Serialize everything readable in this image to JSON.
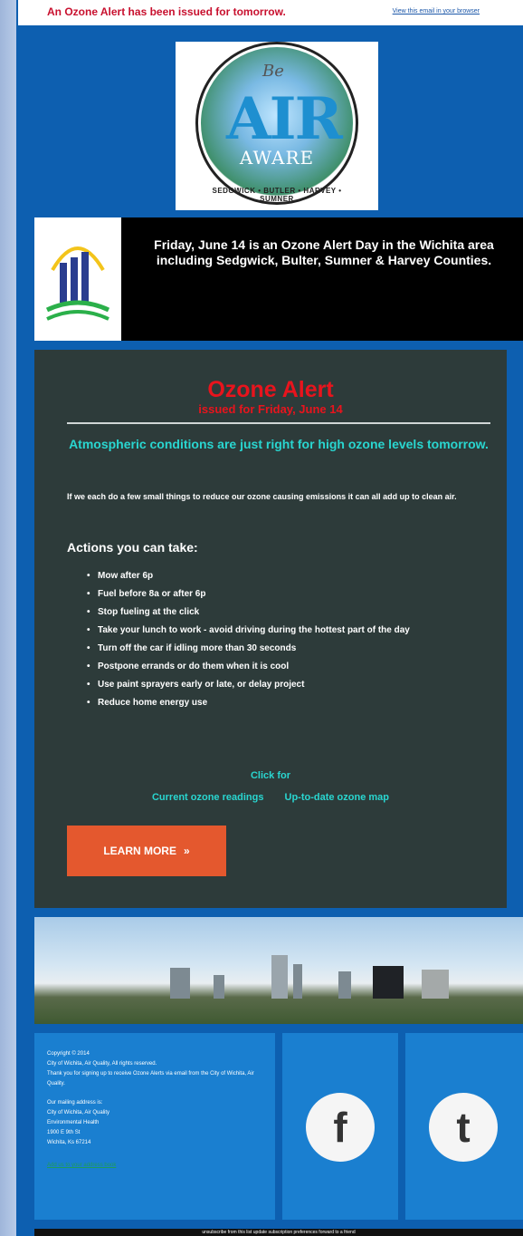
{
  "top": {
    "alert_text": "An Ozone Alert has been issued for tomorrow.",
    "view_in_browser": "View this email in your browser"
  },
  "logo": {
    "be": "Be",
    "air": "AIR",
    "aware": "AWARE",
    "counties": "SEDGWICK • BUTLER • HARVEY • SUMNER"
  },
  "notice": {
    "text": "Friday, June 14 is an Ozone Alert Day in the Wichita area including Sedgwick, Bulter, Sumner & Harvey Counties."
  },
  "alert": {
    "title": "Ozone Alert",
    "subtitle": "issued for Friday, June 14",
    "conditions": "Atmospheric conditions are just right for high ozone levels tomorrow.",
    "intro": "If we each do a few small things to reduce our ozone causing emissions it can all add up to clean air.",
    "actions_heading": "Actions you can take:",
    "actions": [
      "Mow after 6p",
      "Fuel before 8a or after 6p",
      "Stop fueling at the click",
      "Take your lunch to work - avoid driving during the hottest part of the day",
      "Turn off the car if idling more than 30 seconds",
      "Postpone errands or do them when it is cool",
      "Use paint sprayers early or late, or delay project",
      "Reduce home energy use"
    ],
    "click_for": "Click for",
    "link_current": "Current ozone readings",
    "link_map": "Up-to-date ozone map",
    "learn_more": "LEARN MORE",
    "learn_more_icon": "»"
  },
  "footer": {
    "copyright": "Copyright © 2014",
    "org_rights": "City of Wichita, Air Quality, All rights reserved.",
    "thanks": "Thank you for signing up to receive Ozone Alerts via email from the City of Wichita, Air Quality.",
    "mailing_label": "Our mailing address is:",
    "address_1": "City of Wichita, Air Quality",
    "address_2": "Environmental Health",
    "address_3": "1900 E 9th St",
    "address_4": "Wichita, Ks 67214",
    "add_contact": "Add us to your address book",
    "facebook_glyph": "f",
    "twitter_glyph": "t"
  },
  "bottom": {
    "text": "unsubscribe from this list   update subscription preferences   forward to a friend"
  }
}
